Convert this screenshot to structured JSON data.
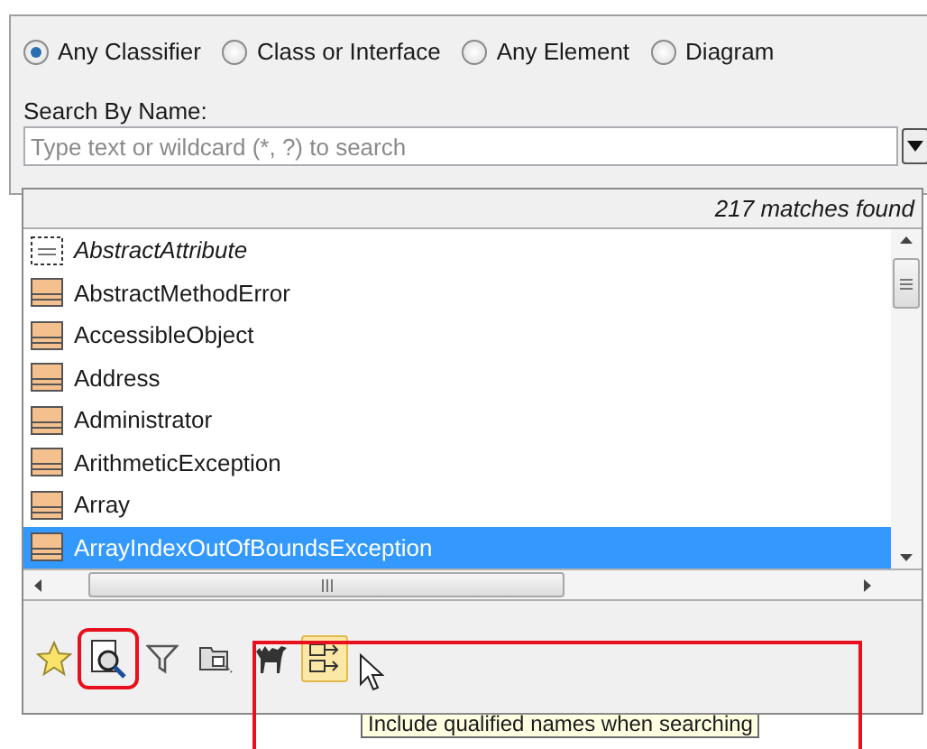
{
  "scope_options": [
    {
      "label": "Any Classifier",
      "selected": true
    },
    {
      "label": "Class or Interface",
      "selected": false
    },
    {
      "label": "Any Element",
      "selected": false
    },
    {
      "label": "Diagram",
      "selected": false
    }
  ],
  "search": {
    "label": "Search By Name:",
    "placeholder": "Type text or wildcard (*, ?) to search"
  },
  "match_count": "217 matches found",
  "results": [
    {
      "name": "AbstractAttribute",
      "kind": "attribute",
      "italic": true,
      "selected": false
    },
    {
      "name": "AbstractMethodError",
      "kind": "class",
      "italic": false,
      "selected": false
    },
    {
      "name": "AccessibleObject",
      "kind": "class",
      "italic": false,
      "selected": false
    },
    {
      "name": "Address",
      "kind": "class",
      "italic": false,
      "selected": false
    },
    {
      "name": "Administrator",
      "kind": "class",
      "italic": false,
      "selected": false
    },
    {
      "name": "ArithmeticException",
      "kind": "class",
      "italic": false,
      "selected": false
    },
    {
      "name": "Array",
      "kind": "class",
      "italic": false,
      "selected": false
    },
    {
      "name": "ArrayIndexOutOfBoundsException",
      "kind": "class",
      "italic": false,
      "selected": true
    }
  ],
  "tools": [
    {
      "kind": "star",
      "pressed": false,
      "highlighted": false
    },
    {
      "kind": "inspect",
      "pressed": false,
      "highlighted": true
    },
    {
      "kind": "filter",
      "pressed": false,
      "highlighted": false
    },
    {
      "kind": "folder",
      "pressed": false,
      "highlighted": false
    },
    {
      "kind": "camel",
      "pressed": false,
      "highlighted": false
    },
    {
      "kind": "qualified",
      "pressed": true,
      "highlighted": false
    }
  ],
  "tooltip": {
    "text": "Include qualified names when searching",
    "framed": true
  }
}
